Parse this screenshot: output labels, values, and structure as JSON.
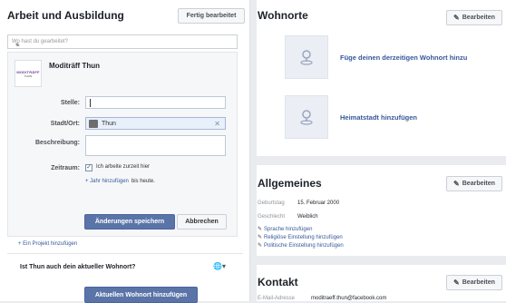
{
  "left": {
    "title": "Arbeit und Ausbildung",
    "done_button": "Fertig bearbeitet",
    "search_placeholder": "Wo hast du gearbeitet?",
    "privacy_icon": "people-icon",
    "org_name": "Moditräff Thun",
    "logo_line1": "MODITRÄFF",
    "logo_line2": "THUN",
    "fields": {
      "position_label": "Stelle:",
      "city_label": "Stadt/Ort:",
      "city_value": "Thun",
      "description_label": "Beschreibung:",
      "period_label": "Zeitraum:",
      "current_job": "Ich arbeite zurzeit hier",
      "add_year": "+ Jahr hinzufügen",
      "until_today": "bis heute."
    },
    "save_button": "Änderungen speichern",
    "cancel_button": "Abbrechen",
    "add_project": "+ Ein Projekt hinzufügen",
    "question": "Ist Thun auch dein aktueller Wohnort?",
    "update_city_button": "Aktuellen Wohnort hinzufügen"
  },
  "right": {
    "places": {
      "title": "Wohnorte",
      "edit_button": "Bearbeiten",
      "current_city": "Füge deinen derzeitigen Wohnort hinzu",
      "hometown": "Heimatstadt hinzufügen"
    },
    "general": {
      "title": "Allgemeines",
      "edit_button": "Bearbeiten",
      "birthday_label": "Geburtstag",
      "birthday_value": "15. Februar 2000",
      "gender_label": "Geschlecht",
      "gender_value": "Weiblich",
      "link_language": "Sprache hinzufügen",
      "link_religion": "Religiöse Einstellung hinzufügen",
      "link_politics": "Politische Einstellung hinzufügen"
    },
    "contact": {
      "title": "Kontakt",
      "edit_button": "Bearbeiten",
      "email_label": "E-Mail-Adresse",
      "email_value": "moditraeff.thun@facebook.com"
    }
  },
  "colors": {
    "link": "#365899",
    "primary_button": "#5b74a8",
    "background": "#e9ebee"
  }
}
